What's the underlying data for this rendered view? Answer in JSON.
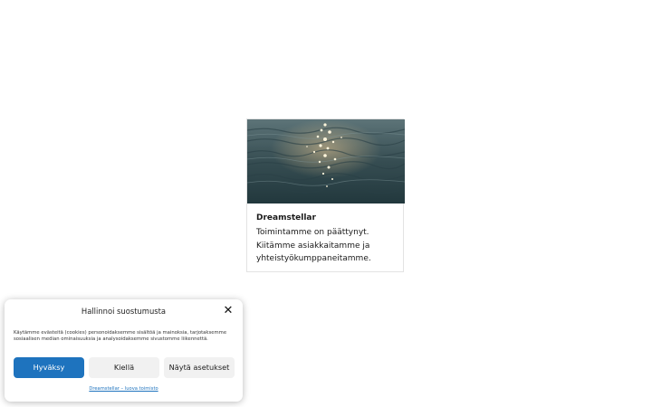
{
  "card": {
    "title": "Dreamstellar",
    "text": "Toimintamme on päättynyt. Kiitämme asiakkaitamme ja yhteistyökumppaneitamme."
  },
  "consent": {
    "title": "Hallinnoi suostumusta",
    "body": "Käytämme evästeitä (cookies) personoidaksemme sisältöä ja mainoksia, tarjotaksemme sosiaalisen median ominaisuuksia ja analysoidaksemme sivustomme liikennettä.",
    "accept_label": "Hyväksy",
    "deny_label": "Kiellä",
    "settings_label": "Näytä asetukset",
    "link_label": "Dreamstellar – luova toimisto"
  },
  "colors": {
    "accent": "#1e73be",
    "secondary_button": "#f1f1f1"
  },
  "icons": {
    "close": "close-icon"
  }
}
